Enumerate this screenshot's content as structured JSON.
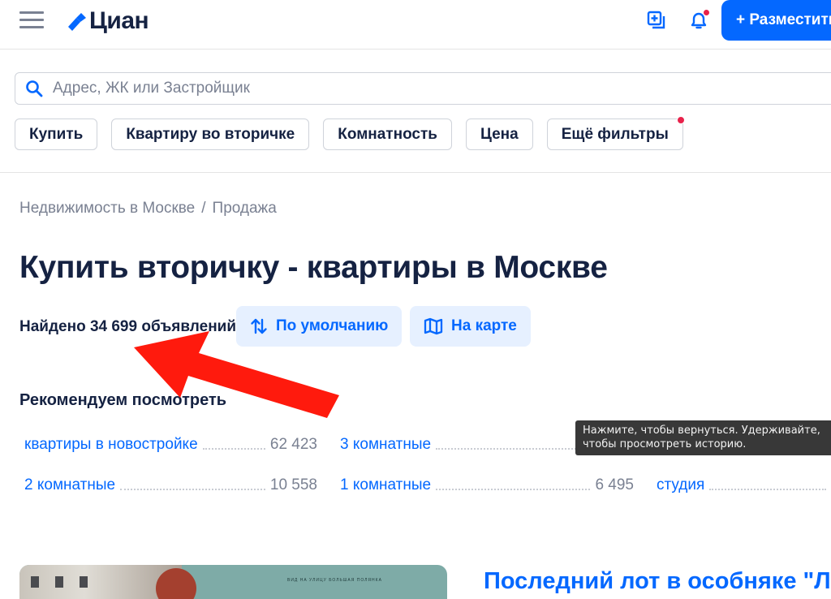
{
  "header": {
    "logo_text": "Циан",
    "place_button": "+ Разместить"
  },
  "search": {
    "placeholder": "Адрес, ЖК или Застройщик"
  },
  "filters": [
    "Купить",
    "Квартиру во вторичке",
    "Комнатность",
    "Цена",
    "Ещё фильтры"
  ],
  "breadcrumb": {
    "first": "Недвижимость в Москве",
    "separator": "/",
    "second": "Продажа"
  },
  "page_title": "Купить вторичку - квартиры в Москве",
  "results": {
    "found": "Найдено 34 699 объявлений",
    "sort_label": "По умолчанию",
    "map_label": "На карте"
  },
  "recommend": {
    "title": "Рекомендуем посмотреть",
    "items": [
      {
        "label": "квартиры в новостройке",
        "count": "62 423"
      },
      {
        "label": "3 комнатные",
        "count": ""
      },
      {
        "label": "2 комнатные",
        "count": "10 558"
      },
      {
        "label": "1 комнатные",
        "count": "6 495"
      },
      {
        "label": "студия",
        "count": ""
      }
    ]
  },
  "tooltip": {
    "line1": "Нажмите, чтобы вернуться. Удерживайте,",
    "line2": "чтобы просмотреть историю."
  },
  "card": {
    "title": "Последний лот в особняке \"Лот",
    "image_caption": "ВИД НА УЛИЦУ БОЛЬШАЯ ПОЛЯНКА"
  },
  "colors": {
    "brand": "#0468ff",
    "text": "#152242",
    "muted": "#7a8192",
    "notification_dot": "#e8224b",
    "annotation_arrow": "#ff1a0d"
  },
  "icons": {
    "menu": "burger-icon",
    "compare": "compare-icon",
    "notifications": "bell-icon",
    "search": "search-icon",
    "sort": "sort-arrows-icon",
    "map": "map-icon"
  }
}
